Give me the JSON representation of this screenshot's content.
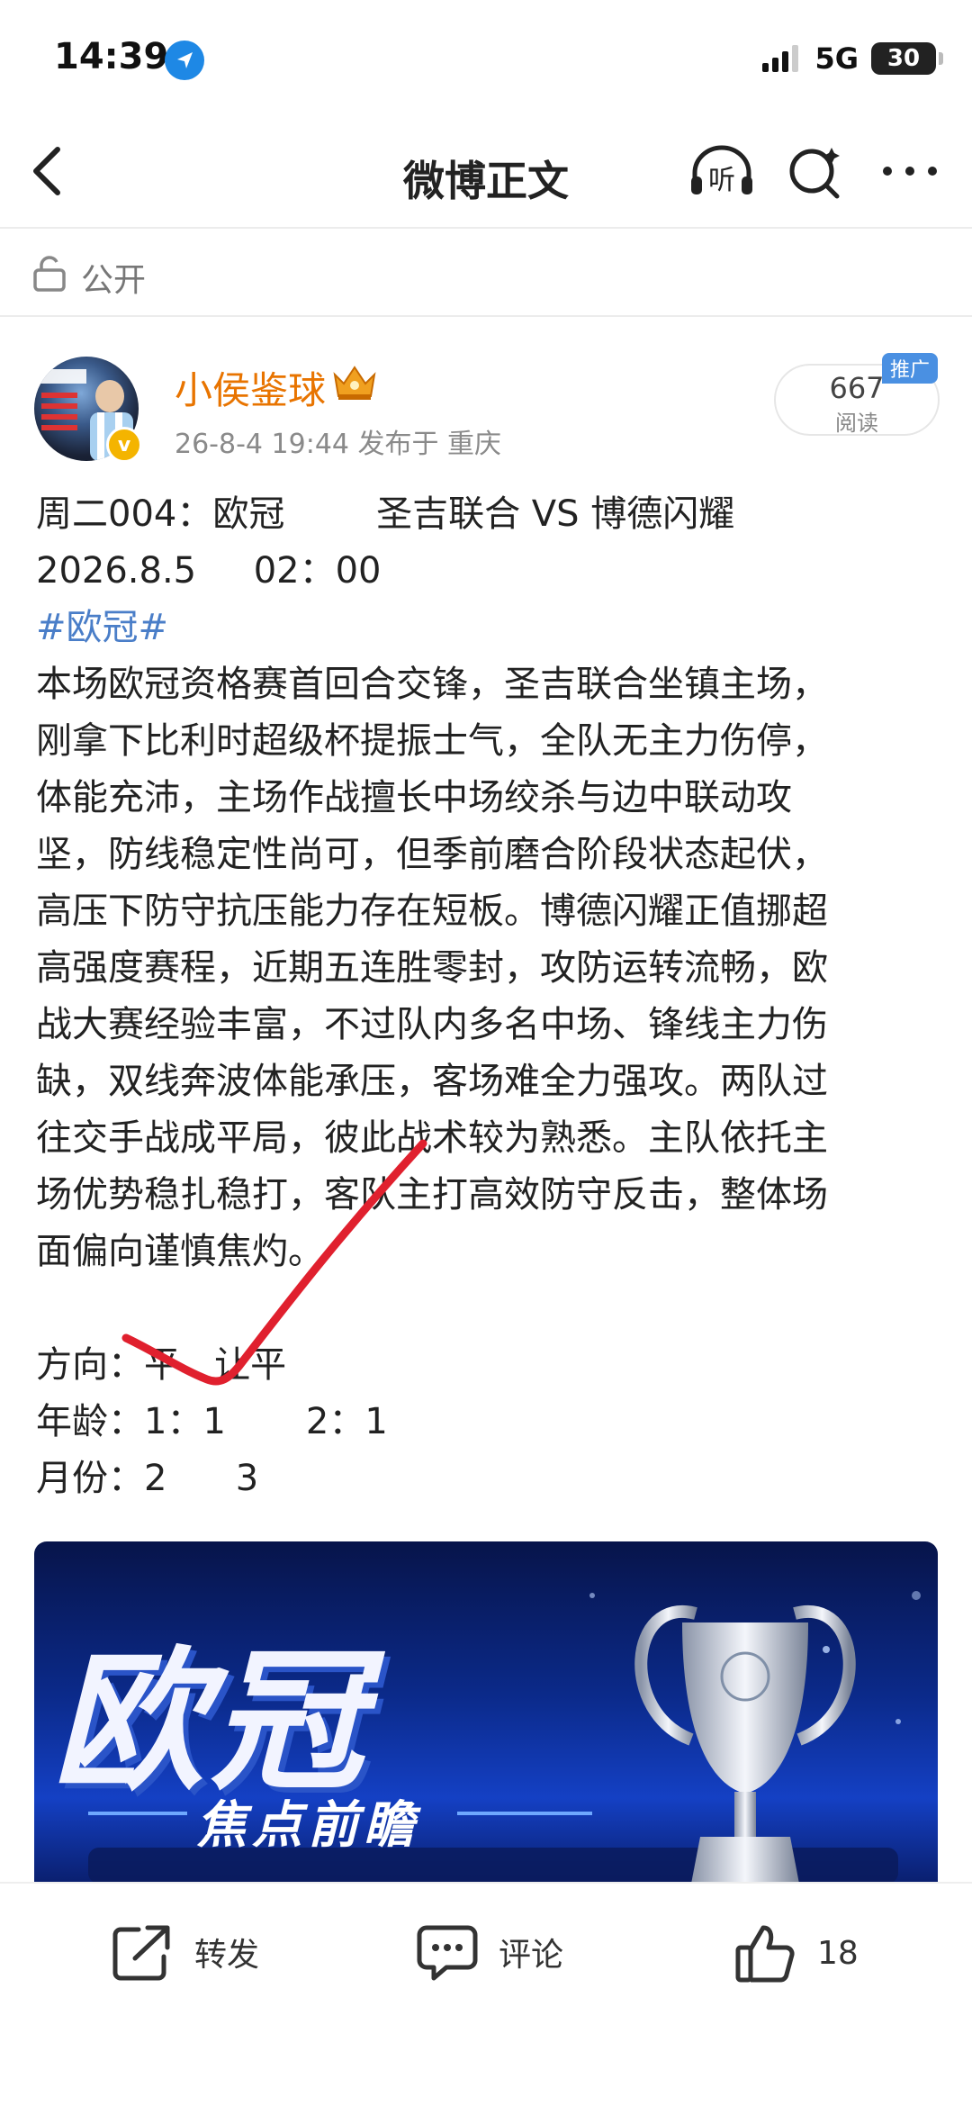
{
  "status_bar": {
    "time": "14:39",
    "network": "5G",
    "battery": "30"
  },
  "nav": {
    "title": "微博正文",
    "listen_label": "听"
  },
  "visibility": {
    "label": "公开"
  },
  "author": {
    "name": "小侯鉴球",
    "avatar_badge": "v",
    "meta": "26-8-4 19:44  发布于 重庆",
    "read_count": "667",
    "read_label": "阅读",
    "promo_tag": "推广"
  },
  "post": {
    "line1": "周二004：欧冠        圣吉联合 VS 博德闪耀",
    "line2": "2026.8.5     02：00",
    "hashtag": "#欧冠#",
    "body_lines": [
      "本场欧冠资格赛首回合交锋，圣吉联合坐镇主场，",
      "刚拿下比利时超级杯提振士气，全队无主力伤停，",
      "体能充沛，主场作战擅长中场绞杀与边中联动攻",
      "坚，防线稳定性尚可，但季前磨合阶段状态起伏，",
      "高压下防守抗压能力存在短板。博德闪耀正值挪超",
      "高强度赛程，近期五连胜零封，攻防运转流畅，欧",
      "战大赛经验丰富，不过队内多名中场、锋线主力伤",
      "缺，双线奔波体能承压，客场难全力强攻。两队过",
      "往交手战成平局，彼此战术较为熟悉。主队依托主",
      "场优势稳扎稳打，客队主打高效防守反击，整体场",
      "面偏向谨慎焦灼。"
    ],
    "direction": "方向：平   让平",
    "age": "年龄：1：1       2：1",
    "month": "月份：2      3"
  },
  "banner": {
    "title": "欧冠",
    "subtitle": "焦点前瞻"
  },
  "actions": {
    "repost": "转发",
    "comment": "评论",
    "like_count": "18"
  },
  "colors": {
    "author": "#e87400",
    "hashtag": "#4a7ec8",
    "check": "#e0202e",
    "banner": "#0b2a8a"
  }
}
